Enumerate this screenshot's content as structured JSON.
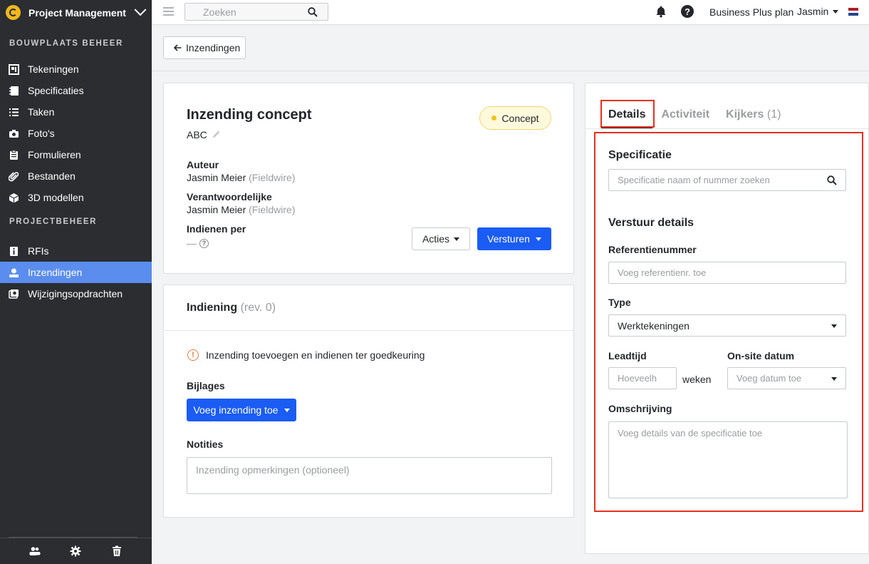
{
  "sidebar": {
    "project_name": "Project Management",
    "section1": "BOUWPLAATS BEHEER",
    "items1": [
      {
        "label": "Tekeningen",
        "icon": "drawings-icon"
      },
      {
        "label": "Specificaties",
        "icon": "specifications-icon"
      },
      {
        "label": "Taken",
        "icon": "tasks-icon"
      },
      {
        "label": "Foto's",
        "icon": "camera-icon"
      },
      {
        "label": "Formulieren",
        "icon": "forms-icon"
      },
      {
        "label": "Bestanden",
        "icon": "paperclip-icon"
      },
      {
        "label": "3D modellen",
        "icon": "cube-icon"
      }
    ],
    "section2": "PROJECTBEHEER",
    "items2": [
      {
        "label": "RFIs",
        "icon": "rfi-icon"
      },
      {
        "label": "Inzendingen",
        "icon": "submittals-icon",
        "active": true
      },
      {
        "label": "Wijzigingsopdrachten",
        "icon": "change-orders-icon"
      }
    ],
    "active_color": "#5a8dee"
  },
  "topbar": {
    "search_placeholder": "Zoeken",
    "plan": "Business Plus plan",
    "user": "Jasmin"
  },
  "back_button": "Inzendingen",
  "submittal": {
    "title": "Inzending concept",
    "subtitle": "ABC",
    "status": "Concept",
    "author_label": "Auteur",
    "author_name": "Jasmin Meier",
    "author_org": "(Fieldwire)",
    "responsible_label": "Verantwoordelijke",
    "responsible_name": "Jasmin Meier",
    "responsible_org": "(Fieldwire)",
    "due_label": "Indienen per",
    "due_value": "—",
    "actions_label": "Acties",
    "send_label": "Versturen"
  },
  "revision": {
    "title": "Indiening",
    "rev": "(rev. 0)",
    "info": "Inzending toevoegen en indienen ter goedkeuring",
    "attachments_label": "Bijlages",
    "add_button": "Voeg inzending toe",
    "notes_label": "Notities",
    "notes_placeholder": "Inzending opmerkingen (optioneel)"
  },
  "details": {
    "tabs": [
      {
        "label": "Details"
      },
      {
        "label": "Activiteit"
      },
      {
        "label": "Kijkers",
        "count": "(1)"
      }
    ],
    "spec_heading": "Specificatie",
    "spec_placeholder": "Specificatie naam of nummer zoeken",
    "send_heading": "Verstuur details",
    "ref_label": "Referentienummer",
    "ref_placeholder": "Voeg referentienr. toe",
    "type_label": "Type",
    "type_value": "Werktekeningen",
    "lead_label": "Leadtijd",
    "lead_placeholder": "Hoeveelh",
    "lead_unit": "weken",
    "onsite_label": "On-site datum",
    "onsite_placeholder": "Voeg datum toe",
    "desc_label": "Omschrijving",
    "desc_placeholder": "Voeg details van de specificatie toe"
  },
  "colors": {
    "primary": "#1a5cf4",
    "highlight": "#e5301f",
    "badge_dot": "#f3c10f"
  }
}
